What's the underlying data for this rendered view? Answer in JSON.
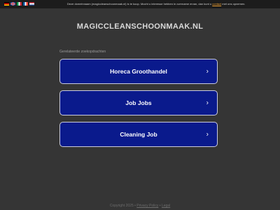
{
  "topbar": {
    "languages": [
      "de",
      "gb",
      "it",
      "fr",
      "nl"
    ],
    "notice_text": "Deze domeinnaam (magiccleanschoonmaak.nl) is te koop. Mocht u interesse hebben in overname ervan, dan kunt u",
    "notice_link": "contact",
    "notice_suffix": "met ons opnemen."
  },
  "site": {
    "title": "MAGICCLEANSCHOONMAAK.NL"
  },
  "related": {
    "label": "Gerelateerde zoekopdrachten",
    "items": [
      {
        "label": "Horeca Groothandel"
      },
      {
        "label": "Job Jobs"
      },
      {
        "label": "Cleaning Job"
      }
    ],
    "chevron": "›"
  },
  "footer": {
    "copyright": "Copyright 2025",
    "sep1": "•",
    "privacy": "Privacy Policy",
    "sep2": "•",
    "legal": "Legal"
  },
  "colors": {
    "background": "#353535",
    "button": "#0a1a8c",
    "topbar": "#1c1c1c"
  }
}
